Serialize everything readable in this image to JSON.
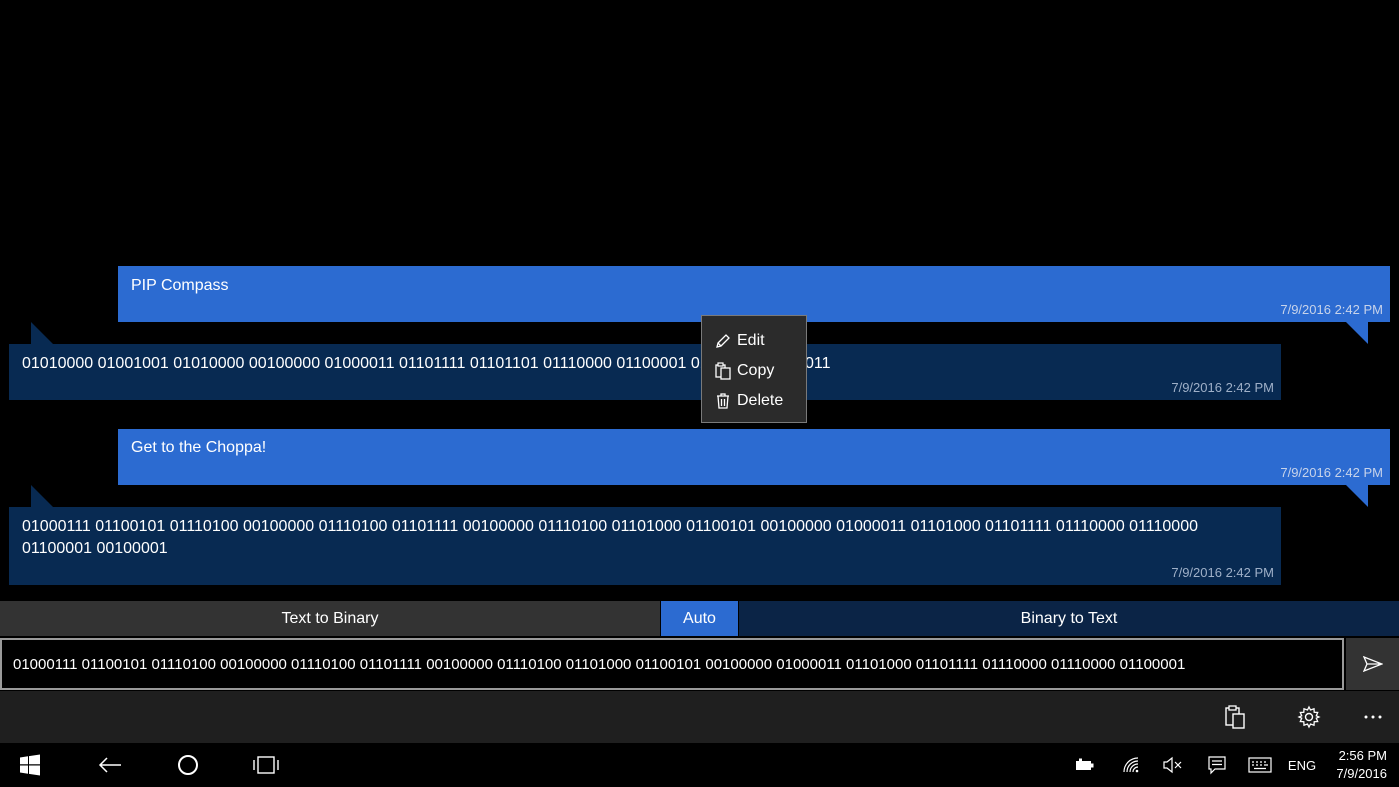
{
  "messages": [
    {
      "text": "PIP Compass",
      "time": "7/9/2016 2:42 PM"
    },
    {
      "text": "01010000 01001001 01010000 00100000 01000011 01101111 01101101 01110000 01100001 01110011 01110011",
      "time": "7/9/2016 2:42 PM"
    },
    {
      "text": "Get to the Choppa!",
      "time": "7/9/2016 2:42 PM"
    },
    {
      "text": "01000111 01100101 01110100 00100000 01110100 01101111 00100000 01110100 01101000 01100101 00100000 01000011 01101000 01101111 01110000 01110000 01100001 00100001",
      "time": "7/9/2016 2:42 PM"
    }
  ],
  "context_menu": {
    "edit": "Edit",
    "copy": "Copy",
    "delete": "Delete"
  },
  "modes": {
    "text_to_binary": "Text to Binary",
    "auto": "Auto",
    "binary_to_text": "Binary to Text"
  },
  "input": {
    "value": "01000111 01100101 01110100 00100000 01110100 01101111 00100000 01110100 01101000 01100101 00100000 01000011 01101000 01101111 01110000 01110000 01100001"
  },
  "command_bar": {
    "icons": [
      "paste-icon",
      "settings-icon",
      "more-icon"
    ]
  },
  "taskbar": {
    "language": "ENG",
    "time": "2:56 PM",
    "date": "7/9/2016"
  },
  "colors": {
    "sent_bubble": "#2c6bd1",
    "received_bubble": "#082a52",
    "background": "#000000"
  }
}
